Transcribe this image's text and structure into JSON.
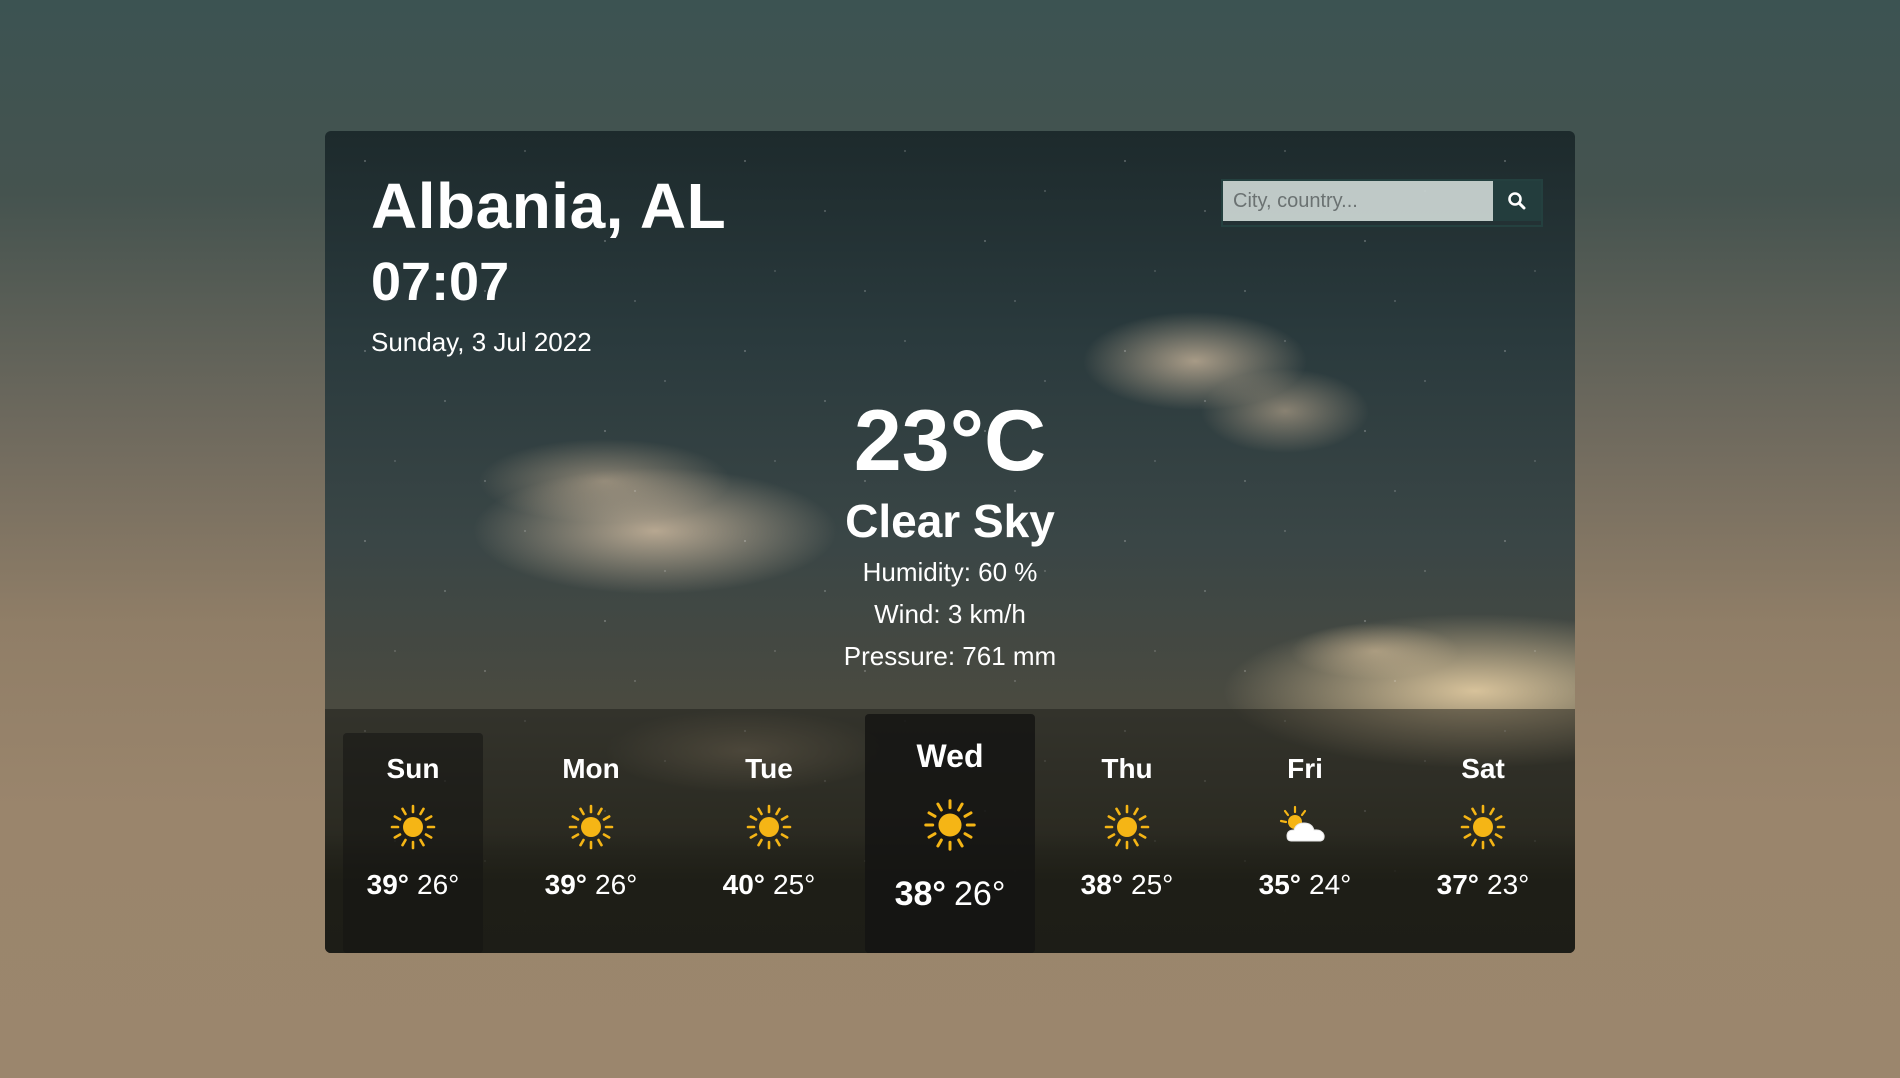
{
  "location": {
    "city": "Albania, AL",
    "time": "07:07",
    "date": "Sunday, 3 Jul 2022"
  },
  "search": {
    "placeholder": "City, country...",
    "value": ""
  },
  "current": {
    "temperature": "23°C",
    "condition": "Clear Sky",
    "humidity": "Humidity: 60 %",
    "wind": "Wind: 3 km/h",
    "pressure": "Pressure: 761 mm"
  },
  "forecast": [
    {
      "day": "Sun",
      "max": "39°",
      "min": "26°",
      "icon": "sun-icon"
    },
    {
      "day": "Mon",
      "max": "39°",
      "min": "26°",
      "icon": "sun-icon"
    },
    {
      "day": "Tue",
      "max": "40°",
      "min": "25°",
      "icon": "sun-icon"
    },
    {
      "day": "Wed",
      "max": "38°",
      "min": "26°",
      "icon": "sun-icon"
    },
    {
      "day": "Thu",
      "max": "38°",
      "min": "25°",
      "icon": "sun-icon"
    },
    {
      "day": "Fri",
      "max": "35°",
      "min": "24°",
      "icon": "partly-cloudy-icon"
    },
    {
      "day": "Sat",
      "max": "37°",
      "min": "23°",
      "icon": "sun-icon"
    }
  ],
  "colors": {
    "sun": "#f5b515",
    "cloud": "#ffffff",
    "search_button": "#233d3d"
  }
}
